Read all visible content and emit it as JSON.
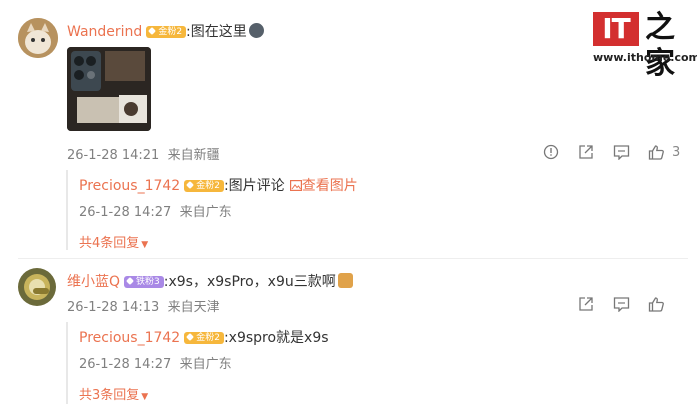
{
  "watermark": {
    "logo_text": "IT",
    "logo_char": "之家",
    "url": "www.ithome.com"
  },
  "comments": [
    {
      "author": "Wanderind",
      "badge": "金粉2",
      "text": ":图在这里",
      "time": "26-1-28 14:21",
      "location": "来自新疆",
      "likes": "3",
      "replies": [
        {
          "author": "Precious_1742",
          "badge": "金粉2",
          "text": ":图片评论",
          "pic_link": "查看图片",
          "time": "26-1-28 14:27",
          "location": "来自广东"
        }
      ],
      "more_replies": "共4条回复"
    },
    {
      "author": "维小蓝Q",
      "badge": "铁粉3",
      "text": ":x9s，x9sPro，x9u三款啊",
      "time": "26-1-28 14:13",
      "location": "来自天津",
      "replies": [
        {
          "author": "Precious_1742",
          "badge": "金粉2",
          "text": ":x9spro就是x9s",
          "time": "26-1-28 14:27",
          "location": "来自广东"
        }
      ],
      "more_replies": "共3条回复"
    }
  ],
  "colors": {
    "name": "#eb7350",
    "meta": "#808080",
    "gold_badge": "#f6b73c",
    "purple_badge": "#a989e6",
    "logo_red": "#d32f2f"
  }
}
